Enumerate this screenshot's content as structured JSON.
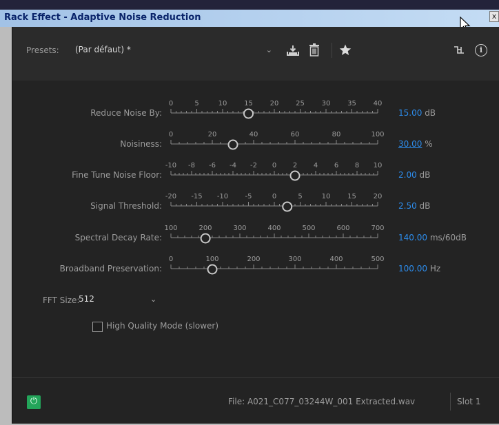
{
  "window": {
    "title": "Rack Effect - Adaptive Noise Reduction",
    "close_glyph": "x"
  },
  "presets": {
    "label": "Presets:",
    "value": "(Par défaut) *",
    "chevron": "⌄"
  },
  "toolbar": {
    "icons": [
      "save-preset-icon",
      "delete-preset-icon",
      "favorite-star-icon",
      "routing-icon",
      "info-icon"
    ],
    "info_glyph": "i"
  },
  "params": [
    {
      "label": "Reduce Noise By:",
      "ticks": [
        "0",
        "5",
        "10",
        "15",
        "20",
        "25",
        "30",
        "35",
        "40"
      ],
      "position": 0.375,
      "value": "15.00",
      "unit": "dB",
      "underline": false
    },
    {
      "label": "Noisiness:",
      "ticks": [
        "0",
        "20",
        "40",
        "60",
        "80",
        "100"
      ],
      "position": 0.3,
      "value": "30.00",
      "unit": "%",
      "underline": true
    },
    {
      "label": "Fine Tune Noise Floor:",
      "ticks": [
        "-10",
        "-8",
        "-6",
        "-4",
        "-2",
        "0",
        "2",
        "4",
        "6",
        "8",
        "10"
      ],
      "position": 0.6,
      "value": "2.00",
      "unit": "dB",
      "underline": false
    },
    {
      "label": "Signal Threshold:",
      "ticks": [
        "-20",
        "-15",
        "-10",
        "-5",
        "0",
        "5",
        "10",
        "15",
        "20"
      ],
      "position": 0.5625,
      "value": "2.50",
      "unit": "dB",
      "underline": false
    },
    {
      "label": "Spectral Decay Rate:",
      "ticks": [
        "100",
        "200",
        "300",
        "400",
        "500",
        "600",
        "700"
      ],
      "position": 0.167,
      "value": "140.00",
      "unit": "ms/60dB",
      "underline": false
    },
    {
      "label": "Broadband Preservation:",
      "ticks": [
        "0",
        "100",
        "200",
        "300",
        "400",
        "500"
      ],
      "position": 0.2,
      "value": "100.00",
      "unit": "Hz",
      "underline": false
    }
  ],
  "fft": {
    "label": "FFT Size:",
    "value": "512",
    "chevron": "⌄"
  },
  "high_quality": {
    "label": "High Quality Mode (slower)",
    "checked": false
  },
  "footer": {
    "power_glyph": "⏻",
    "file": "File: A021_C077_03244W_001 Extracted.wav",
    "slot": "Slot 1"
  },
  "colors": {
    "accent": "#2d8ceb",
    "power": "#23a55a",
    "panel": "#232323",
    "title_text": "#0a246a"
  }
}
